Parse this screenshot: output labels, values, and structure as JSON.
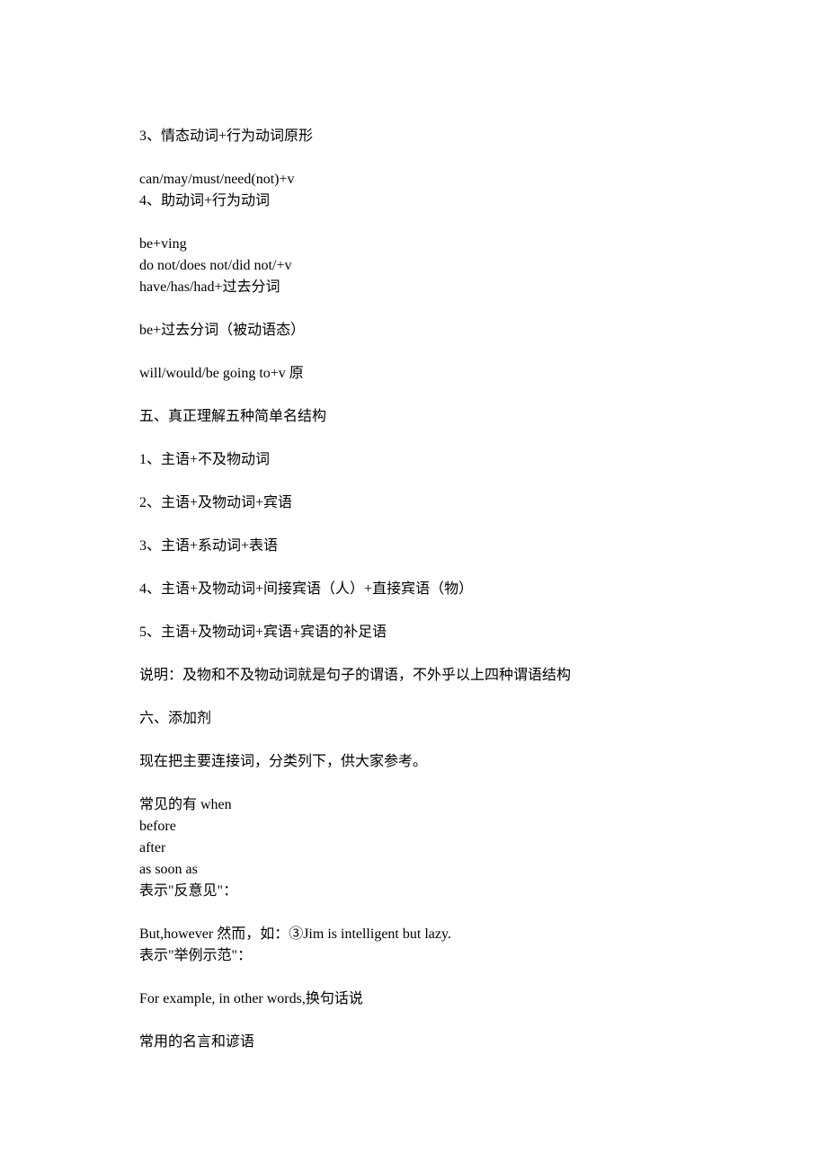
{
  "lines": [
    {
      "text": "3、情态动词+行为动词原形"
    },
    {
      "spacer": true
    },
    {
      "text": "can/may/must/need(not)+v"
    },
    {
      "text": "4、助动词+行为动词"
    },
    {
      "spacer": true
    },
    {
      "text": "be+ving"
    },
    {
      "text": "do not/does not/did not/+v"
    },
    {
      "text": "have/has/had+过去分词"
    },
    {
      "spacer": true
    },
    {
      "text": "be+过去分词（被动语态）"
    },
    {
      "spacer": true
    },
    {
      "text": "will/would/be going to+v 原"
    },
    {
      "spacer": true
    },
    {
      "text": "五、真正理解五种简单名结构"
    },
    {
      "spacer": true
    },
    {
      "text": "1、主语+不及物动词"
    },
    {
      "spacer": true
    },
    {
      "text": "2、主语+及物动词+宾语"
    },
    {
      "spacer": true
    },
    {
      "text": "3、主语+系动词+表语"
    },
    {
      "spacer": true
    },
    {
      "text": "4、主语+及物动词+间接宾语（人）+直接宾语（物）"
    },
    {
      "spacer": true
    },
    {
      "text": "5、主语+及物动词+宾语+宾语的补足语"
    },
    {
      "spacer": true
    },
    {
      "text": "说明：及物和不及物动词就是句子的谓语，不外乎以上四种谓语结构"
    },
    {
      "spacer": true
    },
    {
      "text": "六、添加剂"
    },
    {
      "spacer": true
    },
    {
      "text": "现在把主要连接词，分类列下，供大家参考。"
    },
    {
      "spacer": true
    },
    {
      "text": "常见的有 when"
    },
    {
      "text": "before"
    },
    {
      "text": "after"
    },
    {
      "text": "as soon as"
    },
    {
      "text": "表示\"反意见\"："
    },
    {
      "spacer": true
    },
    {
      "text": "But,however 然而，如：③Jim is intelligent but lazy."
    },
    {
      "text": "表示\"举例示范\"："
    },
    {
      "spacer": true
    },
    {
      "text": "For example, in other words,换句话说"
    },
    {
      "spacer": true
    },
    {
      "text": "常用的名言和谚语"
    }
  ]
}
